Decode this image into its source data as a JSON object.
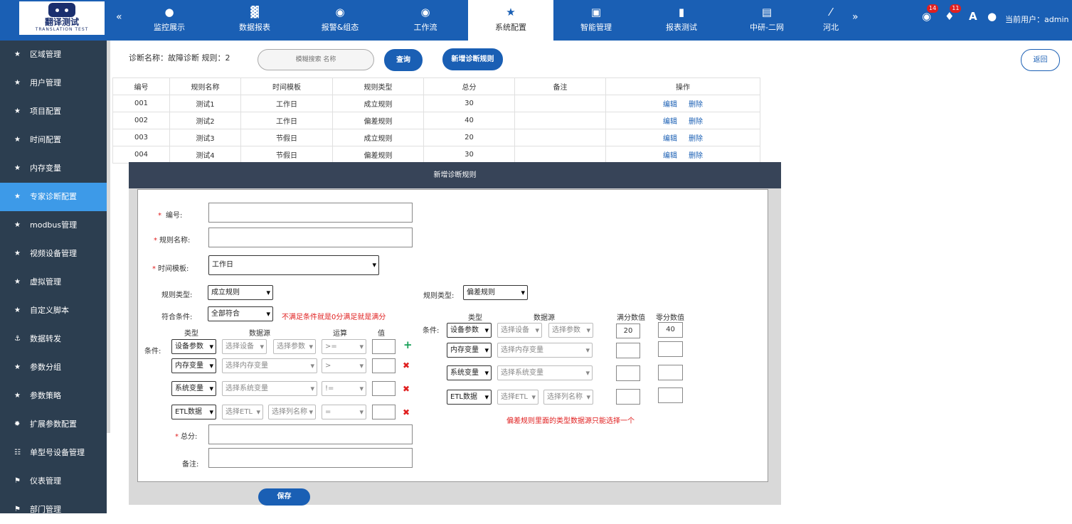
{
  "logo": {
    "text": "翻译测试",
    "subtext": "TRANSLATION TEST"
  },
  "nav": [
    {
      "icon": "user-icon",
      "glyph": "●",
      "label": "监控展示"
    },
    {
      "icon": "bar-chart-icon",
      "glyph": "▓",
      "label": "数据报表"
    },
    {
      "icon": "chat-icon",
      "glyph": "◉",
      "label": "报警&组态"
    },
    {
      "icon": "chat-icon",
      "glyph": "◉",
      "label": "工作流"
    },
    {
      "icon": "star-icon",
      "glyph": "★",
      "label": "系统配置"
    },
    {
      "icon": "gift-icon",
      "glyph": "▣",
      "label": "智能管理"
    },
    {
      "icon": "book-icon",
      "glyph": "▮",
      "label": "报表测试"
    },
    {
      "icon": "document-icon",
      "glyph": "▤",
      "label": "中研-二网"
    },
    {
      "icon": "other-icon",
      "glyph": "⁄",
      "label": "河北"
    }
  ],
  "topbar": {
    "messages_badge": "14",
    "alerts_badge": "11",
    "font_icon": "A",
    "user_label": "当前用户：admin"
  },
  "sidebar": [
    {
      "glyph": "★",
      "label": "区域管理"
    },
    {
      "glyph": "★",
      "label": "用户管理"
    },
    {
      "glyph": "★",
      "label": "项目配置"
    },
    {
      "glyph": "★",
      "label": "时间配置"
    },
    {
      "glyph": "★",
      "label": "内存变量"
    },
    {
      "glyph": "★",
      "label": "专家诊断配置"
    },
    {
      "glyph": "★",
      "label": "modbus管理"
    },
    {
      "glyph": "★",
      "label": "视频设备管理"
    },
    {
      "glyph": "★",
      "label": "虚拟管理"
    },
    {
      "glyph": "★",
      "label": "自定义脚本"
    },
    {
      "glyph": "⚓",
      "label": "数据转发"
    },
    {
      "glyph": "★",
      "label": "参数分组"
    },
    {
      "glyph": "★",
      "label": "参数策略"
    },
    {
      "glyph": "✹",
      "label": "扩展参数配置"
    },
    {
      "glyph": "☷",
      "label": "单型号设备管理"
    },
    {
      "glyph": "⚑",
      "label": "仪表管理"
    },
    {
      "glyph": "⚑",
      "label": "部门管理"
    }
  ],
  "criteria": "诊断名称：故障诊断    规则：2",
  "search": {
    "placeholder": "模糊搜索 名称",
    "query_button": "查询",
    "add_button": "新增诊断规则",
    "back_button": "返回"
  },
  "table": {
    "headers": [
      "编号",
      "规则名称",
      "时间模板",
      "规则类型",
      "总分",
      "备注",
      "操作"
    ],
    "rows": [
      [
        "001",
        "测试1",
        "工作日",
        "成立规则",
        "30",
        ""
      ],
      [
        "002",
        "测试2",
        "工作日",
        "偏差规则",
        "40",
        ""
      ],
      [
        "003",
        "测试3",
        "节假日",
        "成立规则",
        "20",
        ""
      ],
      [
        "004",
        "测试4",
        "节假日",
        "偏差规则",
        "30",
        ""
      ]
    ],
    "edit": "编辑",
    "delete": "删除"
  },
  "dialog": {
    "title": "新增诊断规则",
    "id_label": "编号:",
    "name_label": "规则名称:",
    "template_label": "时间模板:",
    "template_value": "工作日",
    "rule_type_label": "规则类型:",
    "rule_type_value": "成立规则",
    "match_label": "符合条件:",
    "match_value": "全部符合",
    "match_hint": "不满足条件就是0分满足就是满分",
    "cond_label": "条件:",
    "headers": {
      "type": "类型",
      "source": "数据源",
      "op": "运算",
      "value": "值"
    },
    "left_rows": [
      {
        "type": "设备参数",
        "src1": "选择设备",
        "src2": "选择参数",
        "op": ">="
      },
      {
        "type": "内存变量",
        "src1": "选择内存变量",
        "op": ">"
      },
      {
        "type": "系统变量",
        "src1": "选择系统变量",
        "op": "!="
      },
      {
        "type": "ETL数据",
        "src1": "选择ETL",
        "src2": "选择列名称",
        "op": "="
      }
    ],
    "total_label": "总分:",
    "remark_label": "备注:",
    "right_rule_type_label": "规则类型:",
    "right_rule_type_value": "偏差规则",
    "right_cond_label": "条件:",
    "right_headers": {
      "type": "类型",
      "source": "数据源",
      "full": "满分数值",
      "zero": "零分数值"
    },
    "right_rows": [
      {
        "type": "设备参数",
        "src1": "选择设备",
        "src2": "选择参数",
        "full": "20",
        "zero": "40"
      },
      {
        "type": "内存变量",
        "src1": "选择内存变量",
        "full": "",
        "zero": ""
      },
      {
        "type": "系统变量",
        "src1": "选择系统变量",
        "full": "",
        "zero": ""
      },
      {
        "type": "ETL数据",
        "src1": "选择ETL",
        "src2": "选择列名称",
        "full": "",
        "zero": ""
      }
    ],
    "right_hint": "偏差规则里面的类型数据源只能选择一个",
    "save": "保存"
  }
}
